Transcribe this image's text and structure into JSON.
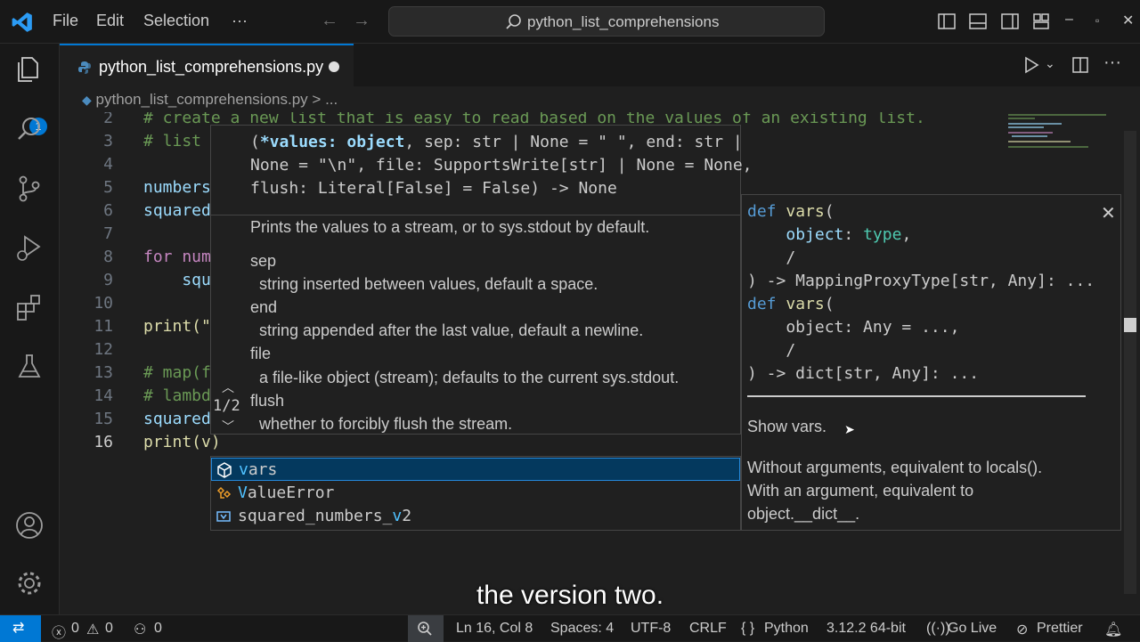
{
  "titlebar": {
    "menu": [
      "File",
      "Edit",
      "Selection",
      "···"
    ],
    "search": "python_list_comprehensions"
  },
  "activitybar": {
    "explorer_badge": "1"
  },
  "tab": {
    "filename": "python_list_comprehensions.py",
    "modified": true
  },
  "breadcrumb": {
    "file": "python_list_comprehensions.py",
    "sep": ">",
    "rest": "..."
  },
  "editor": {
    "line_numbers": [
      "2",
      "3",
      "4",
      "5",
      "6",
      "7",
      "8",
      "9",
      "10",
      "11",
      "12",
      "13",
      "14",
      "15",
      "16"
    ],
    "current_line": "16",
    "visible_code": [
      "# create a new list that is easy to read based on the values of an existing list.",
      "# list",
      "",
      "numbers",
      "squared",
      "",
      "for num",
      "    squ",
      "",
      "print(\"",
      "",
      "# map(f",
      "# lambd",
      "squared",
      "print(v)"
    ]
  },
  "signature_help": {
    "signature_lines": [
      "(*values: object, sep: str | None = \" \", end: str |",
      "None = \"\\n\", file: SupportsWrite[str] | None = None,",
      "flush: Literal[False] = False) -> None"
    ],
    "active_param": "*values: object",
    "summary": "Prints the values to a stream, or to sys.stdout by default.",
    "params": [
      {
        "name": "sep",
        "desc": "string inserted between values, default a space."
      },
      {
        "name": "end",
        "desc": "string appended after the last value, default a newline."
      },
      {
        "name": "file",
        "desc": "a file-like object (stream); defaults to the current sys.stdout."
      },
      {
        "name": "flush",
        "desc": "whether to forcibly flush the stream."
      }
    ],
    "counter": "1/2"
  },
  "suggestions": [
    {
      "match": "v",
      "rest": "ars",
      "icon": "cube-icon",
      "selected": true
    },
    {
      "match": "V",
      "rest": "alueError",
      "icon": "class-icon",
      "selected": false
    },
    {
      "pre": "squared_numbers_",
      "match": "v",
      "rest": "2",
      "icon": "variable-icon",
      "selected": false
    }
  ],
  "details": {
    "overloads": [
      [
        "def vars(",
        "    object: type,",
        "    /",
        ") -> MappingProxyType[str, Any]: ..."
      ],
      [
        "def vars(",
        "    object: Any = ...,",
        "    /",
        ") -> dict[str, Any]: ..."
      ]
    ],
    "summary": "Show vars.",
    "body": [
      "Without arguments, equivalent to locals().",
      "With an argument, equivalent to",
      "object.__dict__."
    ]
  },
  "caption": "the version two.",
  "statusbar": {
    "errors": "0",
    "warnings": "0",
    "ports": "0",
    "position": "Ln 16, Col 8",
    "spaces": "Spaces: 4",
    "encoding": "UTF-8",
    "eol": "CRLF",
    "language": "Python",
    "interpreter": "3.12.2 64-bit",
    "golive": "Go Live",
    "prettier": "Prettier"
  },
  "colors": {
    "accent": "#0078d4",
    "editor_bg": "#1f1f1f",
    "chrome_bg": "#181818",
    "comment": "#6a9955",
    "keyword": "#c586c0"
  }
}
